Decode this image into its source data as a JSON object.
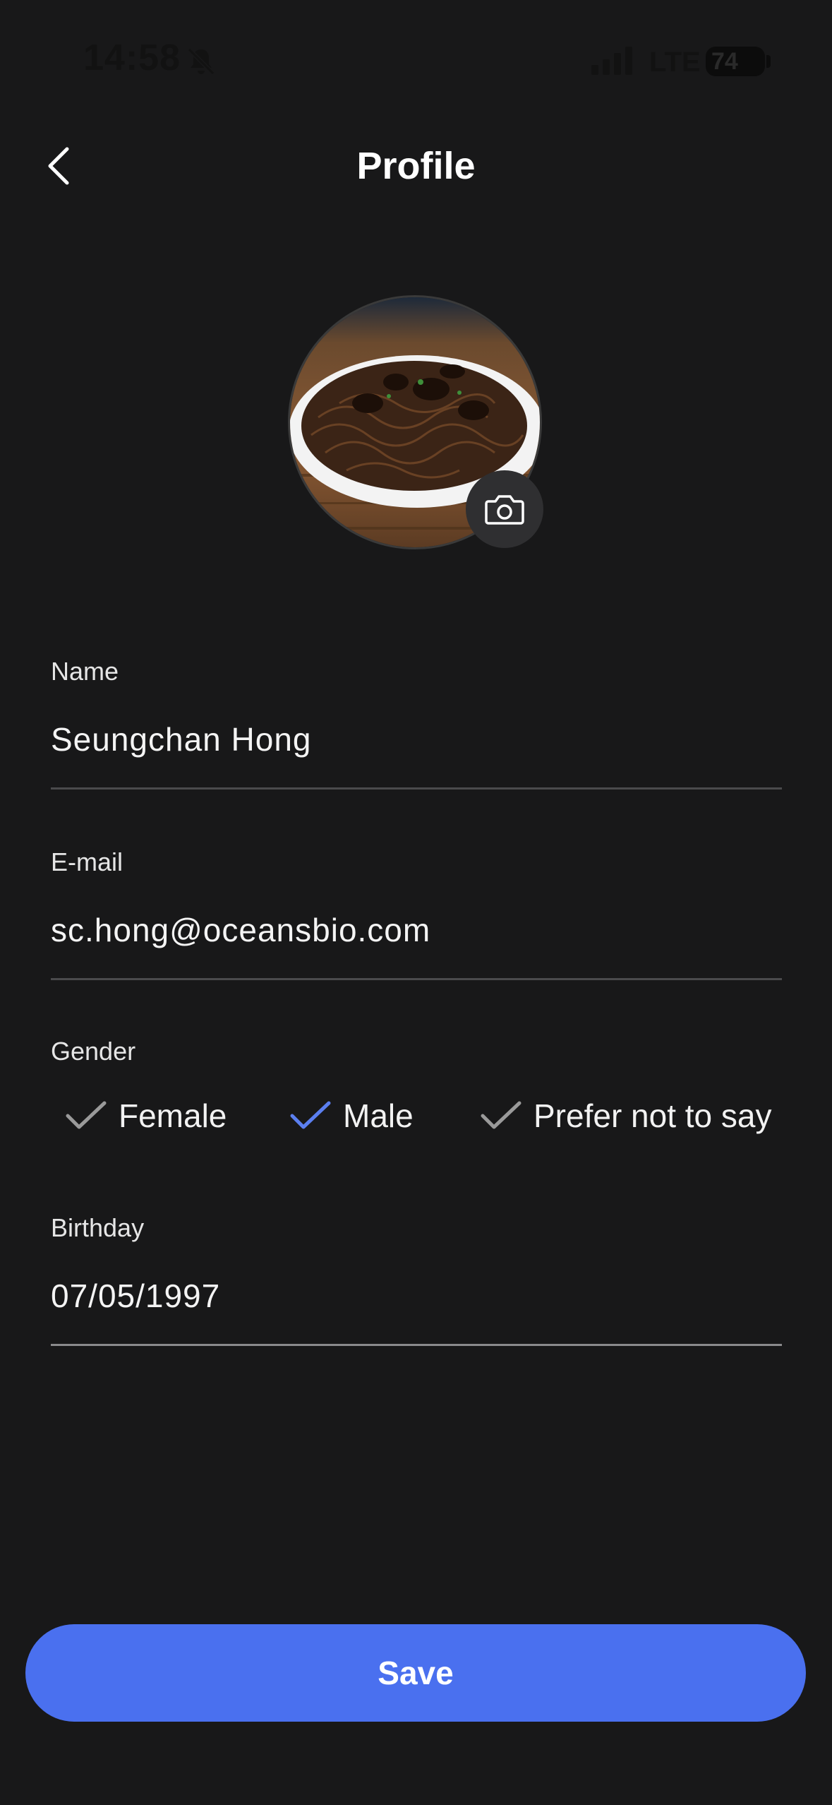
{
  "status_bar": {
    "time": "14:58",
    "network": "LTE",
    "battery": "74",
    "icons": [
      "bell-muted-icon",
      "signal-icon"
    ]
  },
  "header": {
    "title": "Profile",
    "back_icon": "chevron-left-icon"
  },
  "avatar": {
    "photo": "noodle-dish-photo",
    "camera_icon": "camera-icon"
  },
  "form": {
    "name": {
      "label": "Name",
      "value": "Seungchan Hong"
    },
    "email": {
      "label": "E-mail",
      "value": "sc.hong@oceansbio.com"
    },
    "gender": {
      "label": "Gender",
      "options": [
        {
          "label": "Female",
          "selected": false
        },
        {
          "label": "Male",
          "selected": true
        },
        {
          "label": "Prefer not to say",
          "selected": false
        }
      ]
    },
    "birthday": {
      "label": "Birthday",
      "value": "07/05/1997"
    }
  },
  "save_button": {
    "label": "Save"
  },
  "colors": {
    "background": "#181819",
    "accent": "#4a70ef",
    "check_selected": "#5b7ff0",
    "check_unselected": "#9a9a9a"
  }
}
